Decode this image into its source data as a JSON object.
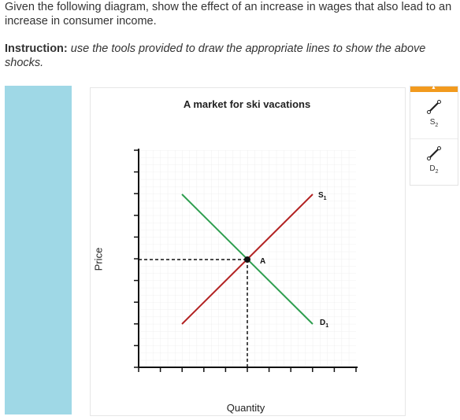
{
  "question": {
    "text": "Given the following diagram, show the effect of an increase in wages that also lead to an increase in consumer income."
  },
  "instruction": {
    "lead": "Instruction:",
    "body": "use the tools provided to draw the appropriate lines to show the above shocks."
  },
  "graph": {
    "title": "A market for ski vacations",
    "xlabel": "Quantity",
    "ylabel": "Price",
    "supply_label": "S",
    "supply_sub": "1",
    "demand_label": "D",
    "demand_sub": "1",
    "equilibrium_label": "A"
  },
  "toolbar": {
    "collapse_glyph": "▲",
    "tools": [
      {
        "name": "S",
        "sub": "2",
        "icon": "line-tool-icon"
      },
      {
        "name": "D",
        "sub": "2",
        "icon": "line-tool-icon"
      }
    ]
  },
  "colors": {
    "supply": "#b22222",
    "demand": "#2e9e4f",
    "panel": "#9fd8e6",
    "accent": "#f29a1e"
  }
}
